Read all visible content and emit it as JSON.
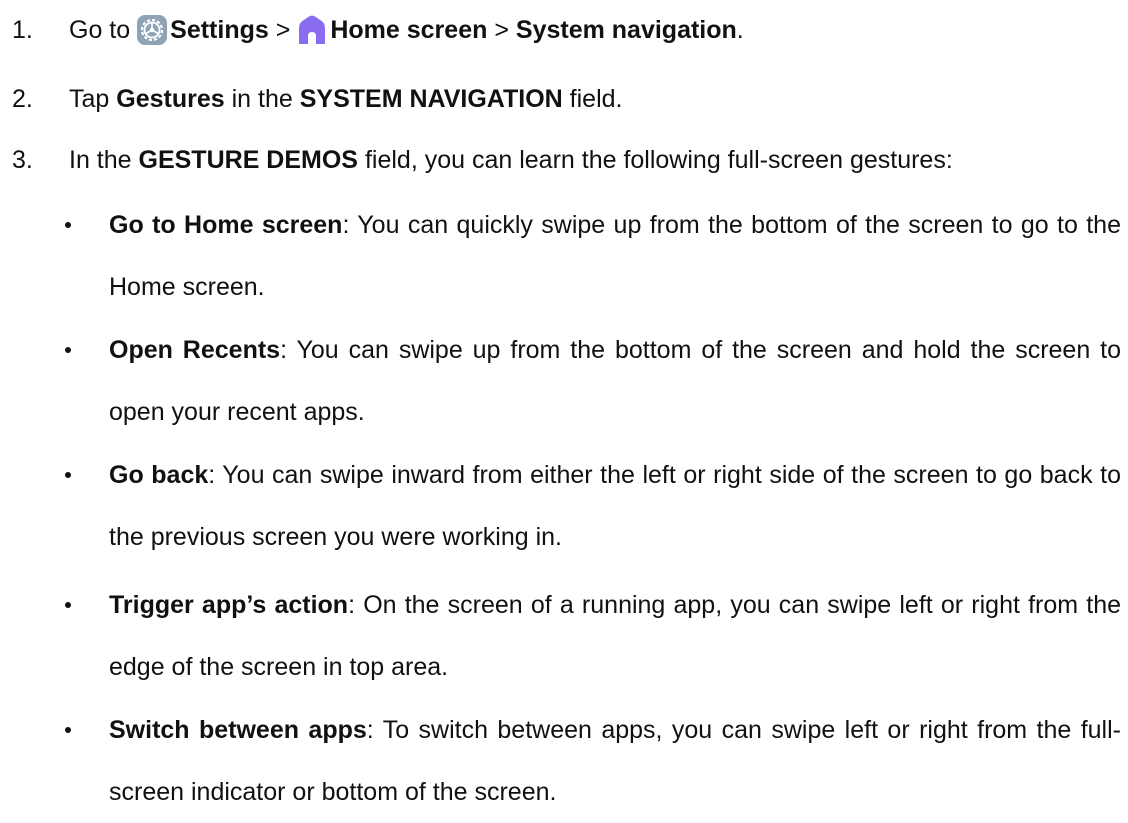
{
  "steps": [
    {
      "number": "1.",
      "goto": "Go to",
      "settings_icon": "settings-gear-icon",
      "settings": "Settings",
      "sep1": ">",
      "home_icon": "home-icon",
      "home_screen": "Home screen",
      "sep2": ">",
      "system_navigation": "System navigation",
      "period": "."
    },
    {
      "number": "2.",
      "tap": "Tap",
      "gestures": "Gestures",
      "in_the": "in the",
      "system_nav_caps": "SYSTEM NAVIGATION",
      "field": "field."
    },
    {
      "number": "3.",
      "in_the": "In the",
      "gesture_demos": "GESTURE DEMOS",
      "rest": "field, you can learn the following full-screen gestures:"
    }
  ],
  "gestures": [
    {
      "title": "Go to Home screen",
      "description": ": You can quickly swipe up from the bottom of the screen to go to the Home screen."
    },
    {
      "title": "Open Recents",
      "description": ": You can swipe up from the bottom of the screen and hold the screen to open your recent apps."
    },
    {
      "title": "Go back",
      "description": ": You can swipe inward from either the left or right side of the screen to go back to the previous screen you were working in."
    },
    {
      "title": "Trigger app’s action",
      "description": ": On the screen of a running app, you can swipe left or right from the edge of the screen in top area."
    },
    {
      "title": "Switch between apps",
      "description": ": To switch between apps, you can swipe left or right from the full-screen indicator or bottom of the screen."
    }
  ],
  "colors": {
    "text": "#111111",
    "settings_icon_bg": "#8fa3b5",
    "home_icon": "#8a6cf0"
  }
}
